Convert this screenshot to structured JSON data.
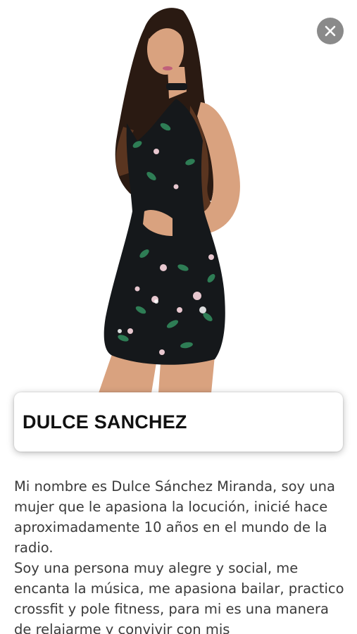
{
  "header": {
    "close_icon": "close-icon"
  },
  "profile": {
    "name": "DULCE SANCHEZ",
    "bio_paragraphs": [
      "Mi nombre es Dulce Sánchez Miranda, soy una mujer que le apasiona la locución, inicié hace aproximadamente 10 años en el mundo de la radio.",
      "Soy una persona muy alegre y social, me encanta la música, me apasiona bailar, practico crossfit y pole fitness, para mi es una manera de relajarme y convivir con mis"
    ]
  },
  "colors": {
    "close_button_bg": "#8a8a8a",
    "dress": "#15181b",
    "skin": "#d9a27f",
    "hair": "#2a1a12",
    "leaf": "#2e7d55",
    "flower": "#e7c7cf"
  }
}
